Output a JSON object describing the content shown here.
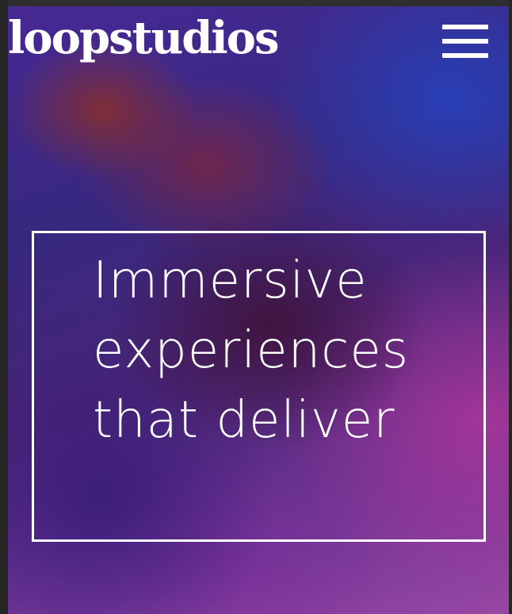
{
  "header": {
    "logo_text": "loopstudios",
    "menu_icon": "hamburger-menu-icon"
  },
  "hero": {
    "headline_lines": [
      "Immersive",
      "experiences",
      "that deliver"
    ]
  },
  "colors": {
    "text": "#ffffff",
    "hero_accent_blue": "#3b2c8a",
    "hero_accent_magenta": "#a04aaa"
  }
}
